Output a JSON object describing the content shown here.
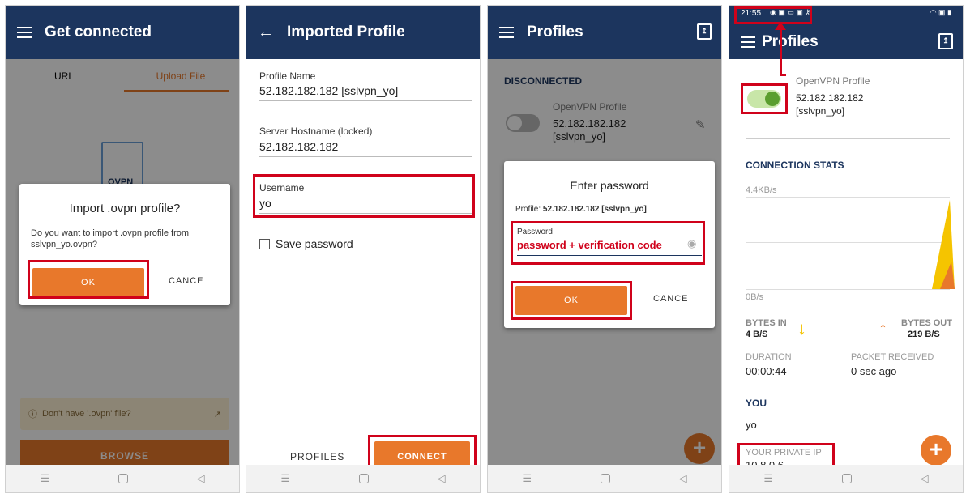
{
  "panel1": {
    "title": "Get connected",
    "tabs": [
      "URL",
      "Upload File"
    ],
    "file_label": "OVPN",
    "dialog_title": "Import .ovpn profile?",
    "dialog_text": "Do you want to import .ovpn profile from sslvpn_yo.ovpn?",
    "ok_label": "OK",
    "cancel_label": "CANCE",
    "info_text": "Don't have '.ovpn' file?",
    "browse_label": "BROWSE"
  },
  "panel2": {
    "title": "Imported Profile",
    "profile_name_label": "Profile Name",
    "profile_name": "52.182.182.182 [sslvpn_yo]",
    "hostname_label": "Server Hostname (locked)",
    "hostname": "52.182.182.182",
    "username_label": "Username",
    "username": "yo",
    "save_password_label": "Save password",
    "profiles_label": "PROFILES",
    "connect_label": "CONNECT"
  },
  "panel3": {
    "title": "Profiles",
    "status": "DISCONNECTED",
    "profile_type": "OpenVPN Profile",
    "profile_name": "52.182.182.182 [sslvpn_yo]",
    "dialog_title": "Enter password",
    "dialog_profile_prefix": "Profile: ",
    "dialog_profile_name": "52.182.182.182 [sslvpn_yo]",
    "password_label": "Password",
    "password_value": "password + verification code",
    "ok_label": "OK",
    "cancel_label": "CANCE"
  },
  "panel4": {
    "status_time": "21:55",
    "title": "Profiles",
    "profile_type": "OpenVPN Profile",
    "profile_name": "52.182.182.182 [sslvpn_yo]",
    "stats_title": "CONNECTION STATS",
    "rate_max": "4.4KB/s",
    "rate_min": "0B/s",
    "bytes_in_label": "BYTES IN",
    "bytes_in": "4 B/S",
    "bytes_out_label": "BYTES OUT",
    "bytes_out": "219 B/S",
    "duration_label": "DURATION",
    "duration": "00:00:44",
    "packet_label": "PACKET RECEIVED",
    "packet": "0 sec ago",
    "you_title": "YOU",
    "you_name": "yo",
    "ip_label": "YOUR PRIVATE IP",
    "ip": "10.8.0.6"
  },
  "colors": {
    "appbar": "#1c355e",
    "accent": "#e8782b",
    "highlight": "#d0021b",
    "toggle_on": "#5a9e2f"
  }
}
